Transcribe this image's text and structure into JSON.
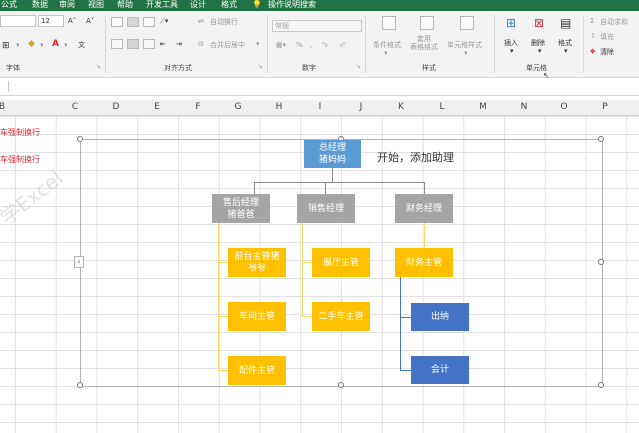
{
  "menu": {
    "tabs": [
      "公式",
      "数据",
      "审阅",
      "视图",
      "帮助",
      "开发工具",
      "设计",
      "格式"
    ],
    "search": "操作说明搜索"
  },
  "ribbon": {
    "font_size": "12",
    "font_group": "字体",
    "align_group": "对齐方式",
    "number_group": "数字",
    "style_group": "样式",
    "cells_group": "单元格",
    "wrap_text": "自动换行",
    "merge_center": "合并后居中",
    "number_format": "常规",
    "conditional_format": "条件格式",
    "table_format": "套用\n表格格式",
    "cell_style": "单元格样式",
    "insert": "插入",
    "delete": "删除",
    "format": "格式",
    "autosum": "自动求和",
    "fill": "填充",
    "clear": "清除",
    "colors": {
      "accent": "#217346",
      "red": "#e0282e",
      "gold": "#ffc000",
      "blue": "#4472c4"
    }
  },
  "sheet": {
    "columns": [
      "B",
      "C",
      "D",
      "E",
      "F",
      "G",
      "H",
      "I",
      "J",
      "K",
      "L",
      "M",
      "N",
      "O",
      "P"
    ],
    "cell_b1": "车强制换行",
    "cell_b2": "车强制换行",
    "watermark": "学Excel"
  },
  "smartart": {
    "annotation": "开始，添加助理",
    "ceo": "总经理\n猪妈妈",
    "manager_aftersales": "售后经理\n猪爸爸",
    "manager_sales": "销售经理",
    "manager_finance": "财务经理",
    "reception": "前台主管猪\n爷爷",
    "showroom": "展厅主管",
    "finance_supervisor": "财务主管",
    "workshop": "车间主管",
    "used_car": "二手车主管",
    "cashier": "出纳",
    "parts": "配件主管",
    "accountant": "会计"
  }
}
